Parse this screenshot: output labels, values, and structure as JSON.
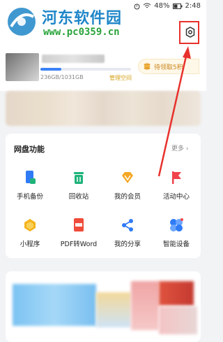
{
  "status_bar": {
    "battery": "48%",
    "time": "2:48"
  },
  "watermark": {
    "title": "河东软件园",
    "url": "www.pc0359.cn"
  },
  "account": {
    "storage_text": "236GB/1031GB",
    "manage_label": "管理空间",
    "storage_used_fraction": 0.229
  },
  "points_button": {
    "label": "待领取5积"
  },
  "features": {
    "title": "网盘功能",
    "more_label": "更多 ›",
    "items": [
      {
        "label": "手机备份",
        "icon": "phone-backup-icon",
        "color": "#2f7bf5"
      },
      {
        "label": "回收站",
        "icon": "trash-icon",
        "color": "#1fb37a"
      },
      {
        "label": "我的会员",
        "icon": "vip-diamond-icon",
        "color": "#f5a623"
      },
      {
        "label": "活动中心",
        "icon": "flag-icon",
        "color": "#f0434b"
      },
      {
        "label": "小程序",
        "icon": "mini-program-icon",
        "color": "#f5b31b"
      },
      {
        "label": "PDF转Word",
        "icon": "pdf-icon",
        "color": "#ef4a3a"
      },
      {
        "label": "我的分享",
        "icon": "share-icon",
        "color": "#2f7bf5"
      },
      {
        "label": "智能设备",
        "icon": "smart-device-icon",
        "color": "#2f7bf5"
      }
    ]
  },
  "colors": {
    "accent": "#2f7bf5",
    "highlight_box": "#e8312c",
    "gold": "#c8861b"
  }
}
